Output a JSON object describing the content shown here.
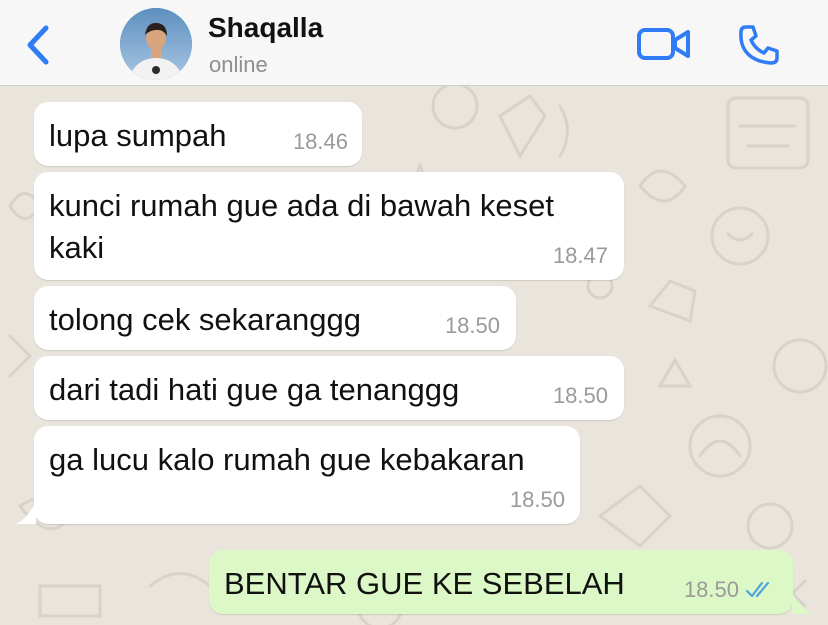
{
  "header": {
    "contact_name": "Shaqalla",
    "contact_status": "online",
    "back_icon": "chevron-left-icon",
    "video_icon": "video-camera-icon",
    "call_icon": "phone-icon",
    "accent_color": "#2f7cf6"
  },
  "messages": [
    {
      "direction": "in",
      "lines": [
        "lupa sumpah"
      ],
      "time": "18.46"
    },
    {
      "direction": "in",
      "lines": [
        "kunci rumah gue ada di bawah keset",
        "kaki"
      ],
      "time": "18.47"
    },
    {
      "direction": "in",
      "lines": [
        "tolong cek sekaranggg"
      ],
      "time": "18.50"
    },
    {
      "direction": "in",
      "lines": [
        "dari tadi hati gue ga tenanggg"
      ],
      "time": "18.50"
    },
    {
      "direction": "in",
      "lines": [
        "ga lucu kalo rumah gue kebakaran"
      ],
      "time": "18.50"
    },
    {
      "direction": "out",
      "lines": [
        "BENTAR GUE KE SEBELAH"
      ],
      "time": "18.50",
      "status": "read"
    }
  ],
  "colors": {
    "incoming_bubble": "#ffffff",
    "outgoing_bubble": "#dcf8c6",
    "read_ticks": "#4fa3e0",
    "chat_background": "#e9e5dc"
  }
}
